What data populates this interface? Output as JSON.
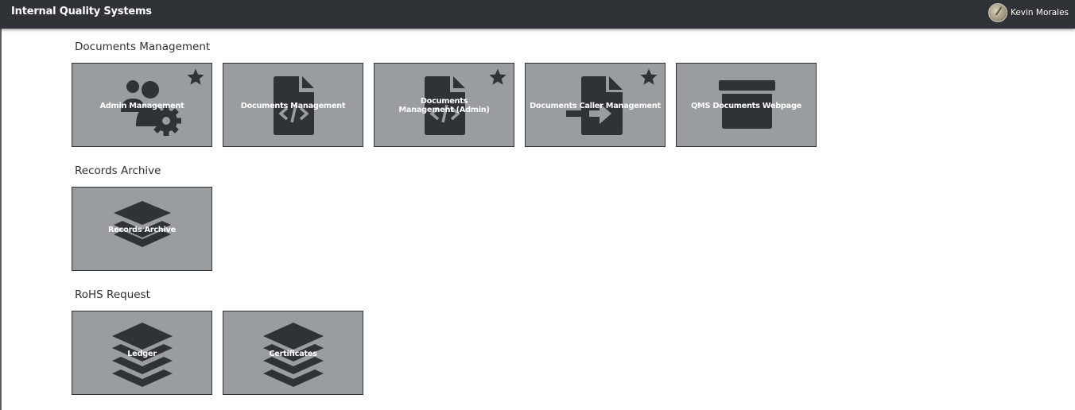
{
  "header": {
    "title": "Internal Quality Systems",
    "user": {
      "name": "Kevin Morales",
      "avatar_icon": "user-avatar-icon"
    }
  },
  "colors": {
    "topbar": "#2f3237",
    "tile_background": "#9a9da0",
    "tile_border": "#2f3237",
    "icon": "#2f3237",
    "label": "#ffffff"
  },
  "sections": [
    {
      "title": "Documents Management",
      "tiles": [
        {
          "label": "Admin Management",
          "icon": "users-cog-icon",
          "favorite": true
        },
        {
          "label": "Documents Management",
          "icon": "file-code-icon",
          "favorite": false
        },
        {
          "label": "Documents Management (Admin)",
          "icon": "file-code-icon",
          "favorite": true
        },
        {
          "label": "Documents Caller Management",
          "icon": "file-import-icon",
          "favorite": true
        },
        {
          "label": "QMS Documents Webpage",
          "icon": "archive-icon",
          "favorite": false
        }
      ]
    },
    {
      "title": "Records Archive",
      "tiles": [
        {
          "label": "Records Archive",
          "icon": "layers-icon",
          "favorite": false
        }
      ]
    },
    {
      "title": "RoHS Request",
      "tiles": [
        {
          "label": "Ledger",
          "icon": "layers-icon",
          "favorite": false
        },
        {
          "label": "Certificates",
          "icon": "layers-icon",
          "favorite": false
        }
      ]
    }
  ]
}
